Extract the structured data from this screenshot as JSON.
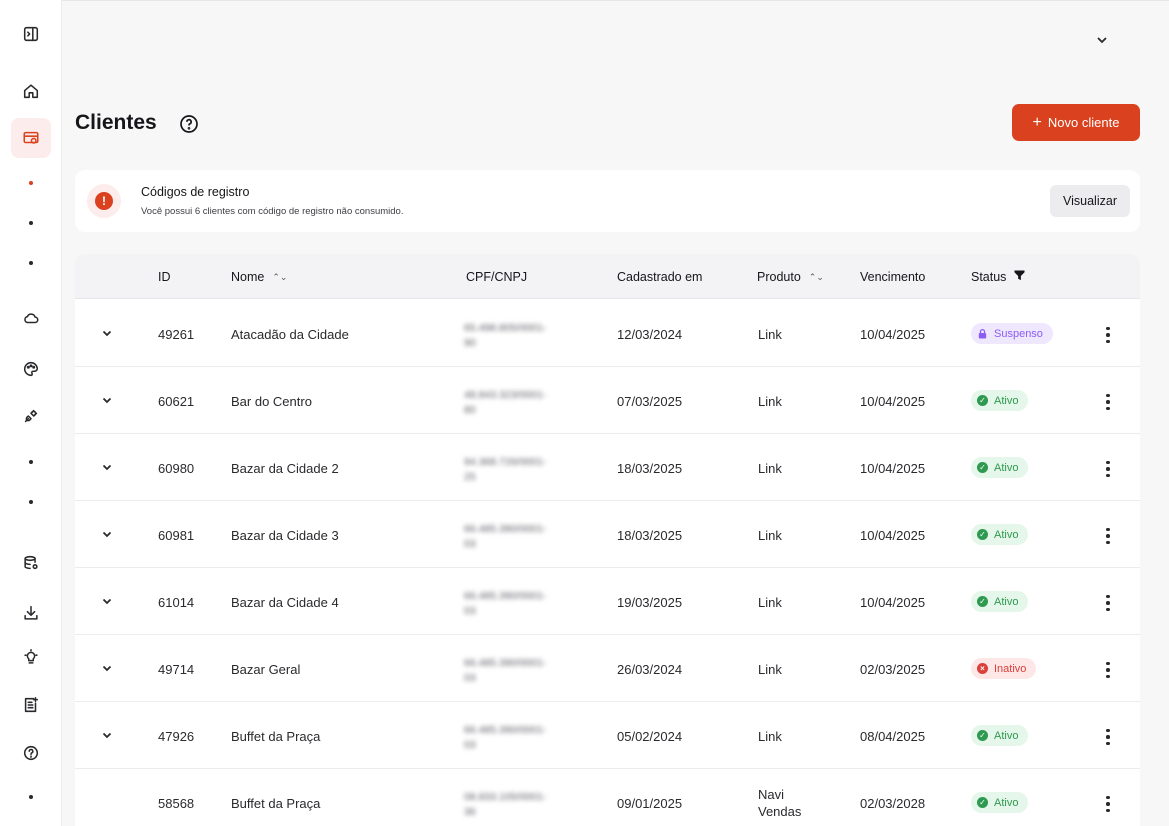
{
  "colors": {
    "accent": "#d9411f",
    "active": "#2e9a4f",
    "inactive": "#d9413a",
    "suspended": "#8b5cf6"
  },
  "sidebar": {
    "items": [
      {
        "icon": "sidebar-toggle-icon"
      },
      {
        "icon": "home-icon"
      },
      {
        "icon": "clients-card-icon",
        "active": true
      },
      {
        "icon": "cloud-icon"
      },
      {
        "icon": "palette-icon"
      },
      {
        "icon": "plug-icon"
      },
      {
        "icon": "database-icon"
      },
      {
        "icon": "download-icon"
      },
      {
        "icon": "lightbulb-icon"
      },
      {
        "icon": "report-icon"
      },
      {
        "icon": "help-icon"
      }
    ]
  },
  "header": {
    "title": "Clientes",
    "new_button": "Novo cliente",
    "new_button_icon": "+"
  },
  "alert": {
    "icon": "!",
    "title": "Códigos de registro",
    "text": "Você possui 6 clientes com código de registro não consumido.",
    "button": "Visualizar"
  },
  "table": {
    "columns": {
      "id": "ID",
      "name": "Nome",
      "doc": "CPF/CNPJ",
      "created": "Cadastrado em",
      "product": "Produto",
      "due": "Vencimento",
      "status": "Status"
    },
    "sort_glyph": "⌃⌄",
    "rows": [
      {
        "id": "49261",
        "name": "Atacadão da Cidade",
        "doc": "65.498.805/0001-",
        "doc2": "90",
        "created": "12/03/2024",
        "product": "Link",
        "product2": "",
        "due": "10/04/2025",
        "status": "Suspenso",
        "status_kind": "suspenso",
        "expandable": true
      },
      {
        "id": "60621",
        "name": "Bar do Centro",
        "doc": "48.843.323/0001-",
        "doc2": "80",
        "created": "07/03/2025",
        "product": "Link",
        "product2": "",
        "due": "10/04/2025",
        "status": "Ativo",
        "status_kind": "ativo",
        "expandable": true
      },
      {
        "id": "60980",
        "name": "Bazar da Cidade 2",
        "doc": "94.368.726/0001-",
        "doc2": "25",
        "created": "18/03/2025",
        "product": "Link",
        "product2": "",
        "due": "10/04/2025",
        "status": "Ativo",
        "status_kind": "ativo",
        "expandable": true
      },
      {
        "id": "60981",
        "name": "Bazar da Cidade 3",
        "doc": "66.485.390/0001-",
        "doc2": "03",
        "created": "18/03/2025",
        "product": "Link",
        "product2": "",
        "due": "10/04/2025",
        "status": "Ativo",
        "status_kind": "ativo",
        "expandable": true
      },
      {
        "id": "61014",
        "name": "Bazar da Cidade 4",
        "doc": "66.485.390/0001-",
        "doc2": "03",
        "created": "19/03/2025",
        "product": "Link",
        "product2": "",
        "due": "10/04/2025",
        "status": "Ativo",
        "status_kind": "ativo",
        "expandable": true
      },
      {
        "id": "49714",
        "name": "Bazar Geral",
        "doc": "66.485.390/0001-",
        "doc2": "03",
        "created": "26/03/2024",
        "product": "Link",
        "product2": "",
        "due": "02/03/2025",
        "status": "Inativo",
        "status_kind": "inativo",
        "expandable": true
      },
      {
        "id": "47926",
        "name": "Buffet da Praça",
        "doc": "66.485.390/0001-",
        "doc2": "03",
        "created": "05/02/2024",
        "product": "Link",
        "product2": "",
        "due": "08/04/2025",
        "status": "Ativo",
        "status_kind": "ativo",
        "expandable": true
      },
      {
        "id": "58568",
        "name": "Buffet da Praça",
        "doc": "08.833.105/0001-",
        "doc2": "36",
        "created": "09/01/2025",
        "product": "Navi",
        "product2": "Vendas",
        "due": "02/03/2028",
        "status": "Ativo",
        "status_kind": "ativo",
        "expandable": false
      }
    ]
  }
}
